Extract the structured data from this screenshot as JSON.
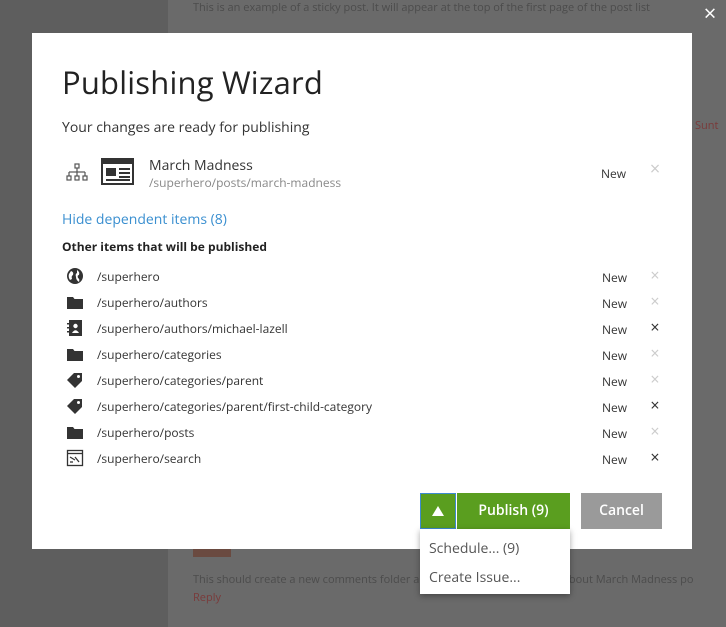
{
  "background": {
    "sticky_text": "This is an example of a sticky post. It will appear at the top of the first page of the post list",
    "meta_text": "",
    "comment_line": "This should create a new comments folder and a bunch of related posts about March Madness post",
    "reply_text": "Reply",
    "red_text": "Sunt"
  },
  "overlay": {
    "close_icon": "×"
  },
  "dialog": {
    "title": "Publishing Wizard",
    "subtitle": "Your changes are ready for publishing",
    "main_item": {
      "name": "March Madness",
      "path": "/superhero/posts/march-madness",
      "status": "New",
      "remove_icon": "×"
    },
    "hide_link": "Hide dependent items (8)",
    "other_heading": "Other items that will be published",
    "dependent_items": [
      {
        "icon": "globe-icon",
        "path": "/superhero",
        "status": "New",
        "remove": "×"
      },
      {
        "icon": "folder-icon",
        "path": "/superhero/authors",
        "status": "New",
        "remove": "×"
      },
      {
        "icon": "contact-icon",
        "path": "/superhero/authors/michael-lazell",
        "status": "New",
        "remove": "×"
      },
      {
        "icon": "folder-icon",
        "path": "/superhero/categories",
        "status": "New",
        "remove": "×"
      },
      {
        "icon": "tag-icon",
        "path": "/superhero/categories/parent",
        "status": "New",
        "remove": "×"
      },
      {
        "icon": "tag-icon",
        "path": "/superhero/categories/parent/first-child-category",
        "status": "New",
        "remove": "×"
      },
      {
        "icon": "folder-icon",
        "path": "/superhero/posts",
        "status": "New",
        "remove": "×"
      },
      {
        "icon": "search-page-icon",
        "path": "/superhero/search",
        "status": "New",
        "remove": "×"
      }
    ],
    "publish_label": "Publish (9)",
    "cancel_label": "Cancel"
  },
  "dropdown": {
    "items": [
      "Schedule... (9)",
      "Create Issue..."
    ]
  },
  "colors": {
    "accent_green": "#5a9e1f",
    "link_blue": "#3a8fd0",
    "cancel_gray": "#9a9a9a"
  }
}
